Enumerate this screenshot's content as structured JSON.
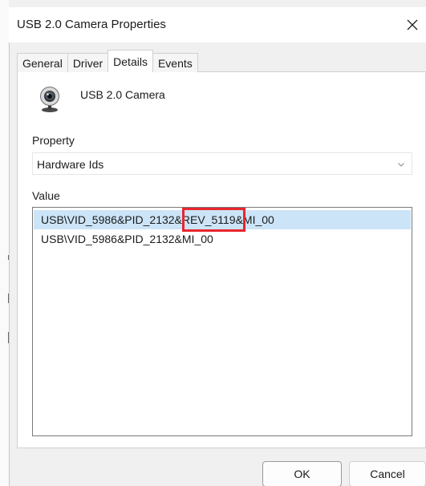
{
  "window": {
    "title": "USB 2.0 Camera Properties",
    "close_icon": "close-icon"
  },
  "tabs": [
    {
      "label": "General",
      "active": false
    },
    {
      "label": "Driver",
      "active": false
    },
    {
      "label": "Details",
      "active": true
    },
    {
      "label": "Events",
      "active": false
    }
  ],
  "device": {
    "name": "USB 2.0 Camera",
    "icon": "webcam-icon"
  },
  "property": {
    "label": "Property",
    "selected": "Hardware Ids"
  },
  "value": {
    "label": "Value",
    "items": [
      {
        "text": "USB\\VID_5986&PID_2132&REV_5119&MI_00",
        "selected": true
      },
      {
        "text": "USB\\VID_5986&PID_2132&MI_00",
        "selected": false
      }
    ]
  },
  "buttons": {
    "ok": "OK",
    "cancel": "Cancel"
  },
  "colors": {
    "selection": "#cce4f7",
    "annotation": "#e8262d"
  }
}
